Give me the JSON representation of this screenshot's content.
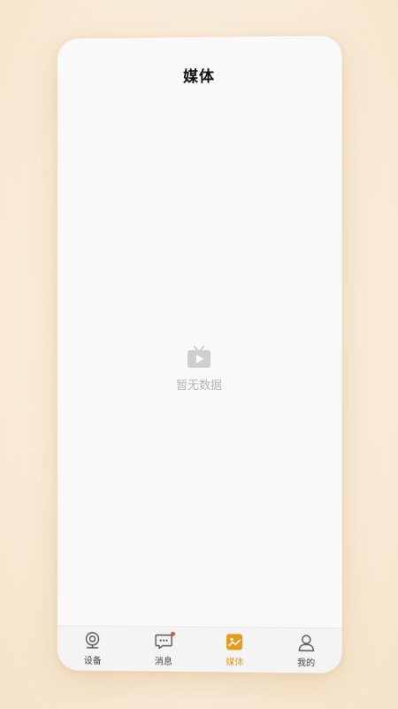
{
  "header": {
    "title": "媒体"
  },
  "empty_state": {
    "icon": "tv-play-icon",
    "text": "暂无数据"
  },
  "tabbar": {
    "items": [
      {
        "label": "设备",
        "icon": "camera-icon",
        "active": false
      },
      {
        "label": "消息",
        "icon": "message-icon",
        "active": false,
        "badge": true
      },
      {
        "label": "媒体",
        "icon": "media-icon",
        "active": true
      },
      {
        "label": "我的",
        "icon": "user-icon",
        "active": false
      }
    ]
  },
  "colors": {
    "accent": "#e89a1b",
    "badge": "#e5533d",
    "muted": "#b5b5b5"
  }
}
